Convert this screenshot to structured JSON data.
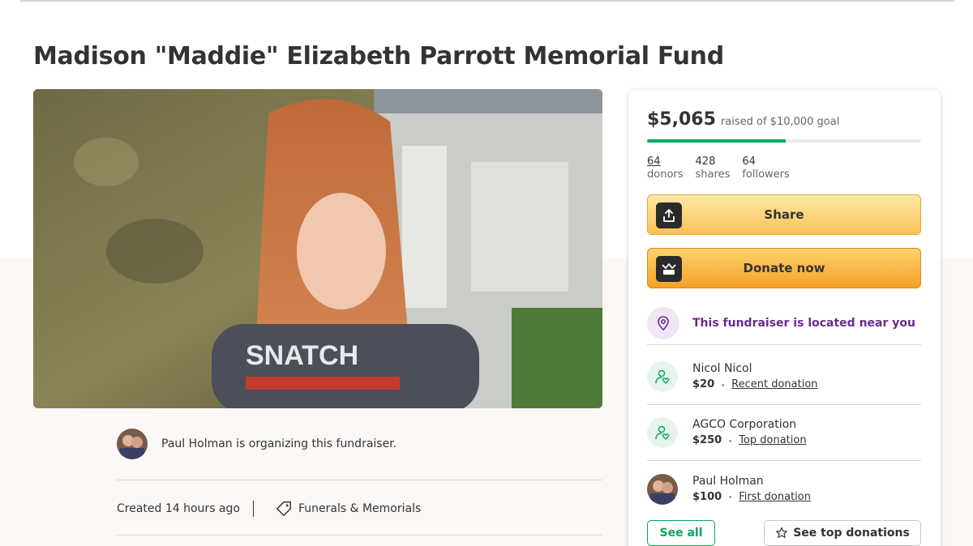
{
  "fundraiser": {
    "title": "Madison \"Maddie\" Elizabeth Parrott Memorial Fund",
    "organizer_text": "Paul Holman is organizing this fundraiser.",
    "created": "Created 14 hours ago",
    "category": "Funerals & Memorials"
  },
  "sidebar": {
    "raised": "$5,065",
    "goal_text": "raised of $10,000 goal",
    "progress_fraction": 0.5065,
    "stats": [
      {
        "value": "64",
        "label": "donors"
      },
      {
        "value": "428",
        "label": "shares"
      },
      {
        "value": "64",
        "label": "followers"
      }
    ],
    "share_label": "Share",
    "donate_label": "Donate now",
    "near_text": "This fundraiser is located near you",
    "donations": [
      {
        "name": "Nicol Nicol",
        "amount": "$20",
        "type": "Recent donation",
        "icon": "donor-heart-icon"
      },
      {
        "name": "AGCO Corporation",
        "amount": "$250",
        "type": "Top donation",
        "icon": "donor-heart-icon"
      },
      {
        "name": "Paul Holman",
        "amount": "$100",
        "type": "First donation",
        "icon": "avatar"
      }
    ],
    "see_all_label": "See all",
    "see_top_label": "See top donations"
  },
  "colors": {
    "brand_green": "#02a95c",
    "near_purple": "#6b2a8e",
    "donate_orange": "#f6a225"
  }
}
